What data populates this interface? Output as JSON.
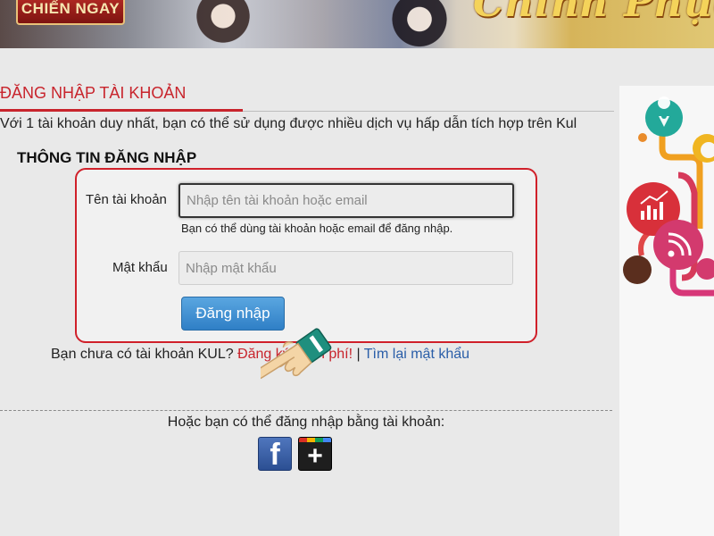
{
  "banner": {
    "play_label": "CHIẾN NGAY",
    "game_title": "Chinh Phục K"
  },
  "section": {
    "title": "ĐĂNG NHẬP TÀI KHOẢN",
    "intro": "Với 1 tài khoản duy nhất, bạn có thể sử dụng được nhiều dịch vụ hấp dẫn tích hợp trên Kul"
  },
  "login": {
    "heading": "THÔNG TIN ĐĂNG NHẬP",
    "username_label": "Tên tài khoản",
    "username_placeholder": "Nhập tên tài khoản hoặc email",
    "username_hint": "Bạn có thể dùng tài khoản hoặc email để đăng nhập.",
    "password_label": "Mật khẩu",
    "password_placeholder": "Nhập mật khẩu",
    "submit_label": "Đăng nhập"
  },
  "register": {
    "prefix": "Bạn chưa có tài khoản KUL? ",
    "register_link": "Đăng ký miễn phí!",
    "separator": " | ",
    "forgot_link": "Tìm lại mật khẩu"
  },
  "social": {
    "prompt": "Hoặc bạn có thể đăng nhập bằng tài khoản:",
    "facebook_glyph": "f",
    "google_glyph": "+"
  },
  "colors": {
    "accent_red": "#c8242c",
    "link_blue": "#2a5ea8",
    "button_blue": "#2f7fc6",
    "hand_teal": "#1f8f7e"
  },
  "icons": [
    "location-pin-icon",
    "chart-icon",
    "rss-icon",
    "facebook-icon",
    "google-plus-icon",
    "hand-pointer-icon"
  ]
}
